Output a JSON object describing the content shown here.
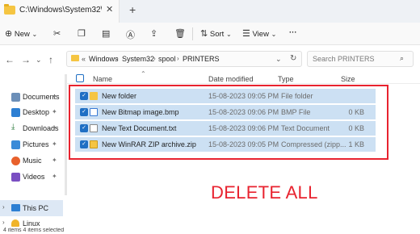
{
  "tab": {
    "title": "C:\\Windows\\System32\\spool\\",
    "close": "✕",
    "new": "+"
  },
  "toolbar": {
    "new_label": "New",
    "sort_label": "Sort",
    "view_label": "View",
    "more_label": "···"
  },
  "nav": {
    "back": "←",
    "forward": "→",
    "up": "↑"
  },
  "address": {
    "segments": [
      "Windows",
      "System32",
      "spool",
      "PRINTERS"
    ],
    "prefix": "«"
  },
  "search": {
    "placeholder": "Search PRINTERS"
  },
  "sidebar": {
    "items": [
      {
        "label": "Documents"
      },
      {
        "label": "Desktop"
      },
      {
        "label": "Downloads"
      },
      {
        "label": "Pictures"
      },
      {
        "label": "Music"
      },
      {
        "label": "Videos"
      }
    ],
    "this_pc": "This PC",
    "next": "Linux"
  },
  "columns": {
    "name": "Name",
    "date": "Date modified",
    "type": "Type",
    "size": "Size"
  },
  "files": [
    {
      "name": "New folder",
      "date": "15-08-2023 09:05 PM",
      "type": "File folder",
      "size": ""
    },
    {
      "name": "New Bitmap image.bmp",
      "date": "15-08-2023 09:06 PM",
      "type": "BMP File",
      "size": "0 KB"
    },
    {
      "name": "New Text Document.txt",
      "date": "15-08-2023 09:06 PM",
      "type": "Text Document",
      "size": "0 KB"
    },
    {
      "name": "New WinRAR ZIP archive.zip",
      "date": "15-08-2023 09:05 PM",
      "type": "Compressed (zipp...",
      "size": "1 KB"
    }
  ],
  "annotation": "DELETE ALL",
  "status": "4 items    4 items selected",
  "colors": {
    "accent": "#1f6fc4",
    "selection": "#cce0f3",
    "annotation": "#e8232f",
    "folder": "#f5c542"
  }
}
